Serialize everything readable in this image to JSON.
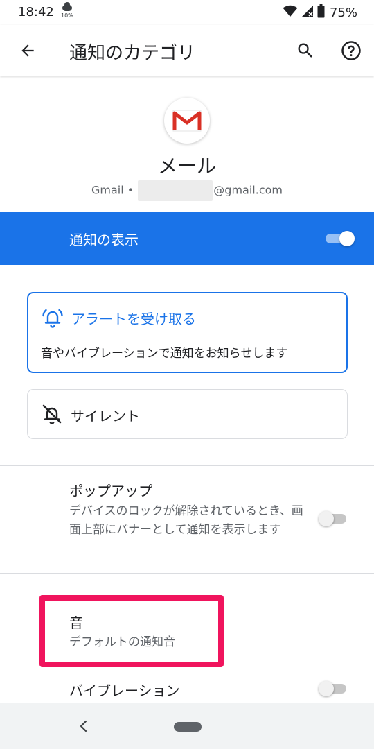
{
  "status_bar": {
    "time": "18:42",
    "weather_pct": "10%",
    "battery_pct": "75%"
  },
  "app_bar": {
    "title": "通知のカテゴリ",
    "back_icon": "arrow-back-icon",
    "search_icon": "search-icon",
    "help_icon": "help-icon"
  },
  "header": {
    "app_icon": "gmail-icon",
    "app_name": "メール",
    "account_prefix": "Gmail •",
    "account_suffix": "@gmail.com"
  },
  "show_notifications": {
    "label": "通知の表示",
    "enabled": true
  },
  "alert_option": {
    "title": "アラートを受け取る",
    "description": "音やバイブレーションで通知をお知らせします",
    "selected": true,
    "icon": "bell-ringing-icon"
  },
  "silent_option": {
    "title": "サイレント",
    "selected": false,
    "icon": "bell-off-icon"
  },
  "popup": {
    "title": "ポップアップ",
    "description": "デバイスのロックが解除されているとき、画面上部にバナーとして通知を表示します",
    "enabled": false
  },
  "sound": {
    "title": "音",
    "description": "デフォルトの通知音"
  },
  "vibration": {
    "title": "バイブレーション",
    "enabled": false
  },
  "colors": {
    "accent": "#1a73e8",
    "highlight": "#f0145d"
  }
}
